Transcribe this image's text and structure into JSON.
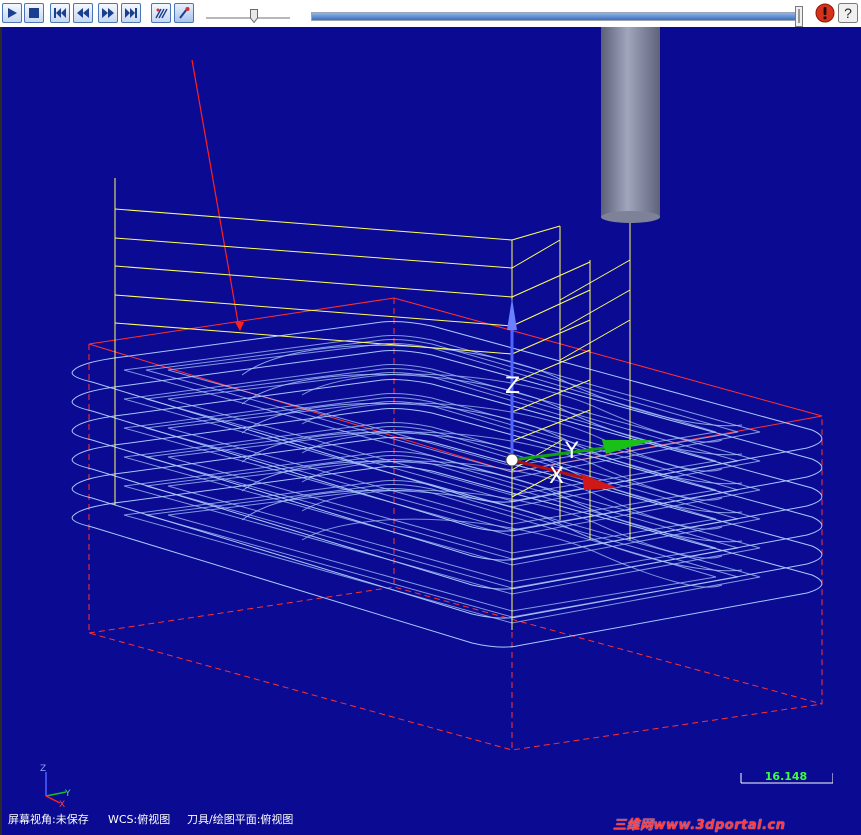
{
  "toolbar": {
    "buttons": [
      {
        "name": "play-button",
        "icon": "play-icon"
      },
      {
        "name": "stop-button",
        "icon": "stop-icon"
      },
      {
        "name": "go-to-start-button",
        "icon": "skip-start-icon"
      },
      {
        "name": "step-back-button",
        "icon": "rewind-icon"
      },
      {
        "name": "step-forward-button",
        "icon": "fast-forward-icon"
      },
      {
        "name": "go-to-end-button",
        "icon": "skip-end-icon"
      },
      {
        "name": "toolpath-display-button",
        "icon": "toolpath-icon"
      },
      {
        "name": "tool-display-button",
        "icon": "tool-icon"
      }
    ],
    "speed_slider_fraction": 0.55,
    "progress_fraction": 1.0,
    "right_buttons": [
      {
        "name": "stop-simulation-button",
        "icon": "exclamation-icon",
        "color": "#d8301a"
      },
      {
        "name": "help-button",
        "icon": "question-icon"
      }
    ]
  },
  "viewport": {
    "background": "#0a0a92",
    "axis_labels": {
      "x": "X",
      "y": "Y",
      "z": "Z"
    },
    "triad_labels": {
      "x": "X",
      "y": "Y",
      "z": "Z"
    },
    "colors": {
      "toolpath": "#a9c8ff",
      "stock_box": "#ff3030",
      "plunge_lines": "#ffff66",
      "tool": "#8a8fa8",
      "x_axis": "#cc1010",
      "y_axis": "#10b010",
      "z_axis": "#5a6cff"
    }
  },
  "status_bar": {
    "screen_view": "屏幕视角:未保存",
    "wcs": "WCS:俯视图",
    "tool_plane": "刀具/绘图平面:俯视图"
  },
  "scale": {
    "value": "16.148"
  },
  "watermark": "三维网www.3dportal.cn"
}
